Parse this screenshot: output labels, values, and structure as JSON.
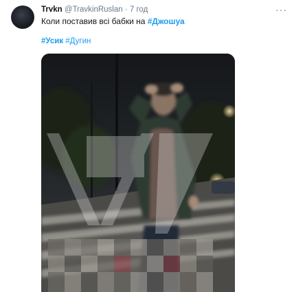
{
  "tweet": {
    "author_name": "Trvkn",
    "author_handle": "@TravkinRuslan",
    "separator": "·",
    "time": "7 год",
    "text": "Коли поставив всі бабки на ",
    "text_hashtag": "#Джошуа",
    "hashtags": [
      "#Усик",
      "#Дугин"
    ],
    "more_icon": "more-icon"
  },
  "colors": {
    "link": "#1d9bf0",
    "secondary_text": "#6b7a88",
    "primary_text": "#0f1419"
  }
}
